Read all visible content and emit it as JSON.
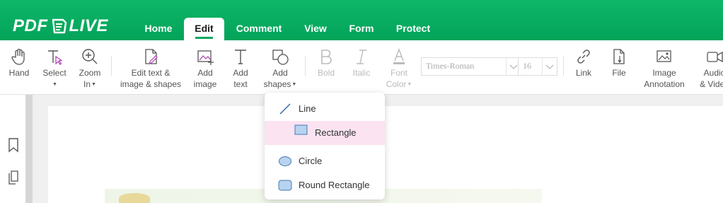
{
  "app": {
    "logo_left": "PDF",
    "logo_right": "LIVE"
  },
  "nav": {
    "tabs": [
      "Home",
      "Edit",
      "Comment",
      "View",
      "Form",
      "Protect"
    ],
    "active": "Edit"
  },
  "toolbar": {
    "hand": "Hand",
    "select": "Select",
    "zoom": "Zoom\nIn",
    "edit_text": "Edit text &\nimage & shapes",
    "add_image": "Add\nimage",
    "add_text": "Add\ntext",
    "add_shapes": "Add\nshapes",
    "bold": "Bold",
    "italic": "Italic",
    "font_color": "Font\nColor",
    "font_family": "Times-Roman",
    "font_size": "16",
    "link": "Link",
    "file": "File",
    "image_annotation": "Image\nAnnotation",
    "audio_video": "Audio\n& Video"
  },
  "shapes_menu": {
    "items": [
      "Line",
      "Rectangle",
      "Circle",
      "Round Rectangle"
    ],
    "highlighted": "Rectangle"
  },
  "colors": {
    "brand_green": "#06a85d",
    "highlight": "#fbe3f2",
    "shape_fill": "#b7d3f0",
    "shape_stroke": "#4a7ab5"
  }
}
